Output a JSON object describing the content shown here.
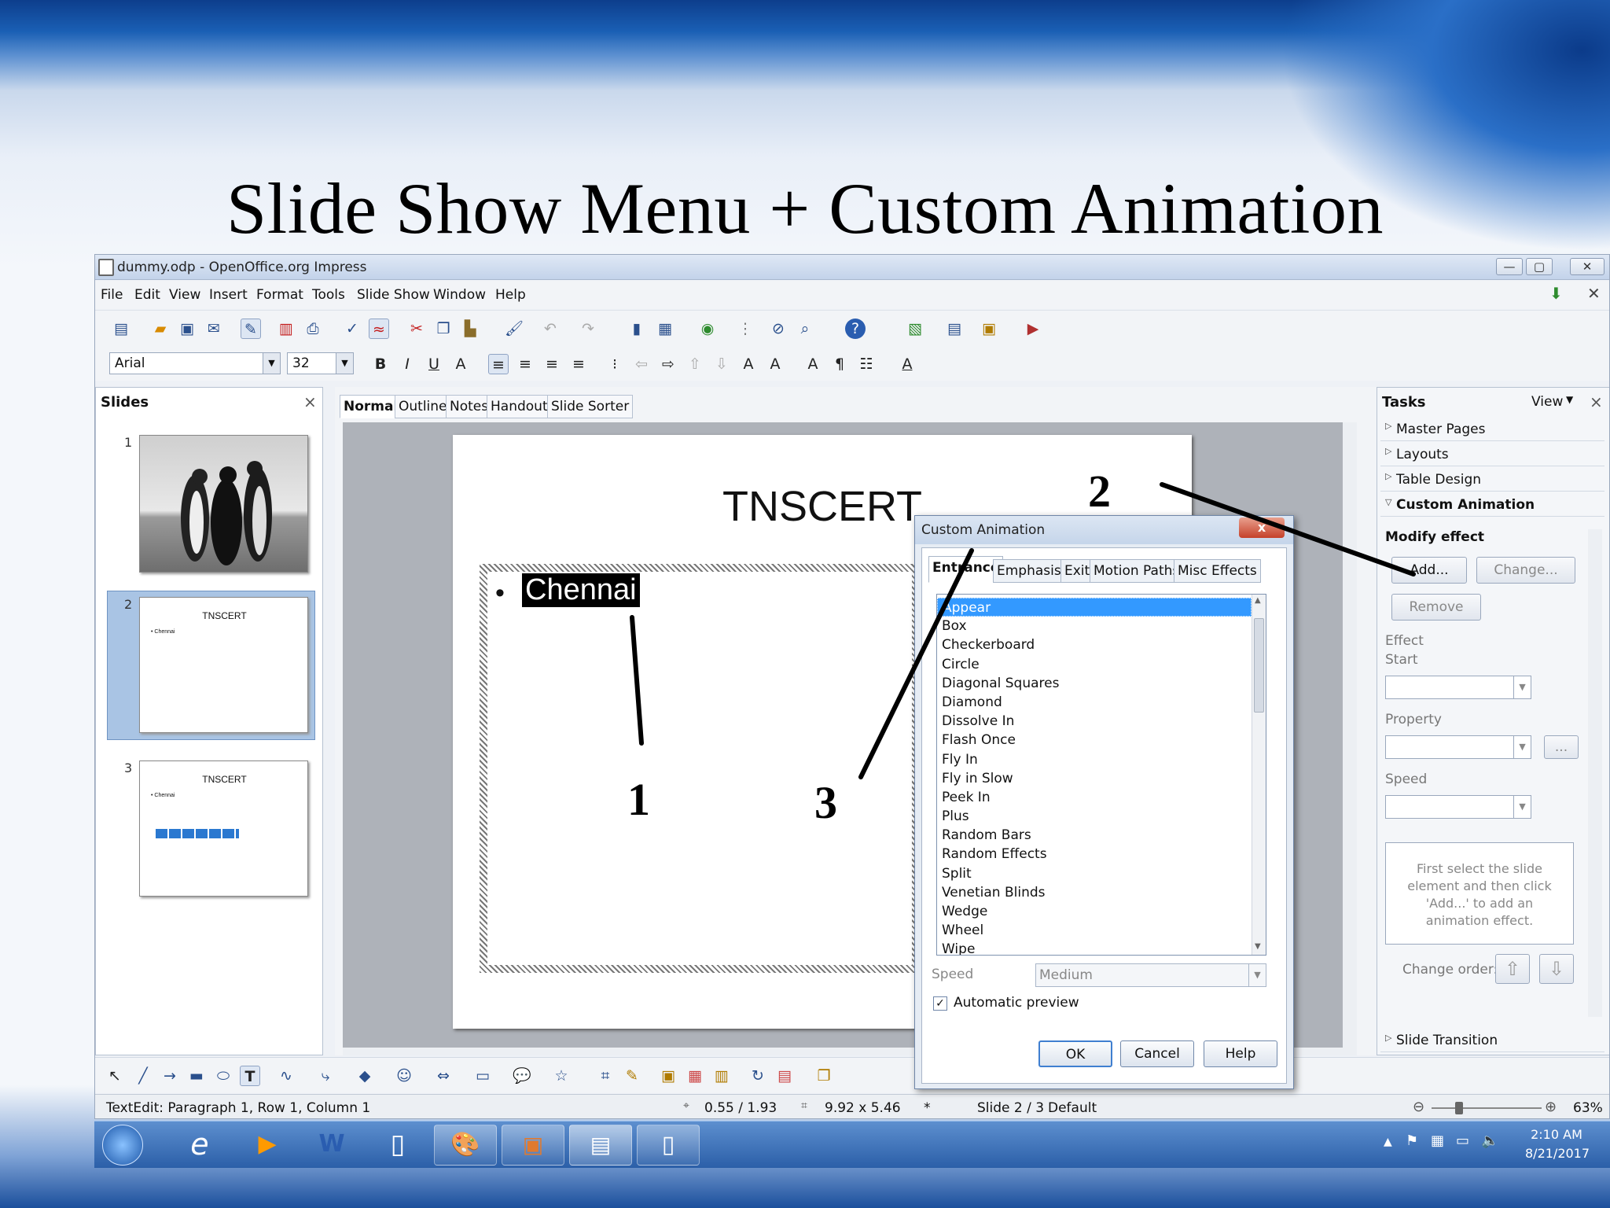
{
  "slide_title": "Slide Show Menu + Custom Animation",
  "window": {
    "title": "dummy.odp - OpenOffice.org Impress",
    "controls": [
      "—",
      "▢",
      "✕"
    ]
  },
  "menu": [
    "File",
    "Edit",
    "View",
    "Insert",
    "Format",
    "Tools",
    "Slide Show",
    "Window",
    "Help"
  ],
  "formatting": {
    "font": "Arial",
    "size": "32"
  },
  "slides_panel": {
    "title": "Slides",
    "close": "×",
    "items": [
      {
        "num": "1",
        "title": "",
        "bullet": ""
      },
      {
        "num": "2",
        "title": "TNSCERT",
        "bullet": "• Chennai"
      },
      {
        "num": "3",
        "title": "TNSCERT",
        "bullet": "• Chennai"
      }
    ]
  },
  "view_tabs": [
    "Normal",
    "Outline",
    "Notes",
    "Handout",
    "Slide Sorter"
  ],
  "slide": {
    "title": "TNSCERT",
    "bullet_symbol": "•",
    "bullet": "Chennai"
  },
  "annotations": [
    "1",
    "2",
    "3"
  ],
  "tasks": {
    "title": "Tasks",
    "view_label": "View",
    "close": "×",
    "rows": [
      "Master Pages",
      "Layouts",
      "Table Design",
      "Custom Animation"
    ],
    "modify_effect": "Modify effect",
    "add": "Add...",
    "change": "Change...",
    "remove": "Remove",
    "effect": "Effect",
    "start": "Start",
    "property": "Property",
    "speed": "Speed",
    "property_btn": "...",
    "hint": "First select the slide element and then click 'Add...' to add an animation effect.",
    "change_order": "Change order:",
    "slide_transition": "Slide Transition"
  },
  "dialog": {
    "title": "Custom Animation",
    "close": "x",
    "tabs": [
      "Entrance",
      "Emphasis",
      "Exit",
      "Motion Paths",
      "Misc Effects"
    ],
    "effects": [
      "Appear",
      "Box",
      "Checkerboard",
      "Circle",
      "Diagonal Squares",
      "Diamond",
      "Dissolve In",
      "Flash Once",
      "Fly In",
      "Fly in Slow",
      "Peek In",
      "Plus",
      "Random Bars",
      "Random Effects",
      "Split",
      "Venetian Blinds",
      "Wedge",
      "Wheel",
      "Wipe"
    ],
    "speed_label": "Speed",
    "speed_value": "Medium",
    "auto_preview": "Automatic preview",
    "auto_preview_checked": true,
    "ok": "OK",
    "cancel": "Cancel",
    "help": "Help"
  },
  "status": {
    "text": "TextEdit: Paragraph 1, Row 1, Column 1",
    "position": "0.55 / 1.93",
    "size": "9.92 x 5.46",
    "modified": "*",
    "slide": "Slide 2 / 3",
    "layout": "Default",
    "zoom": "63%"
  },
  "taskbar": {
    "time": "2:10 AM",
    "date": "8/21/2017"
  },
  "colors": {
    "selection": "#3399ff",
    "title_bar": "#c5d5ea",
    "taskbar": "#2b5fa8"
  }
}
